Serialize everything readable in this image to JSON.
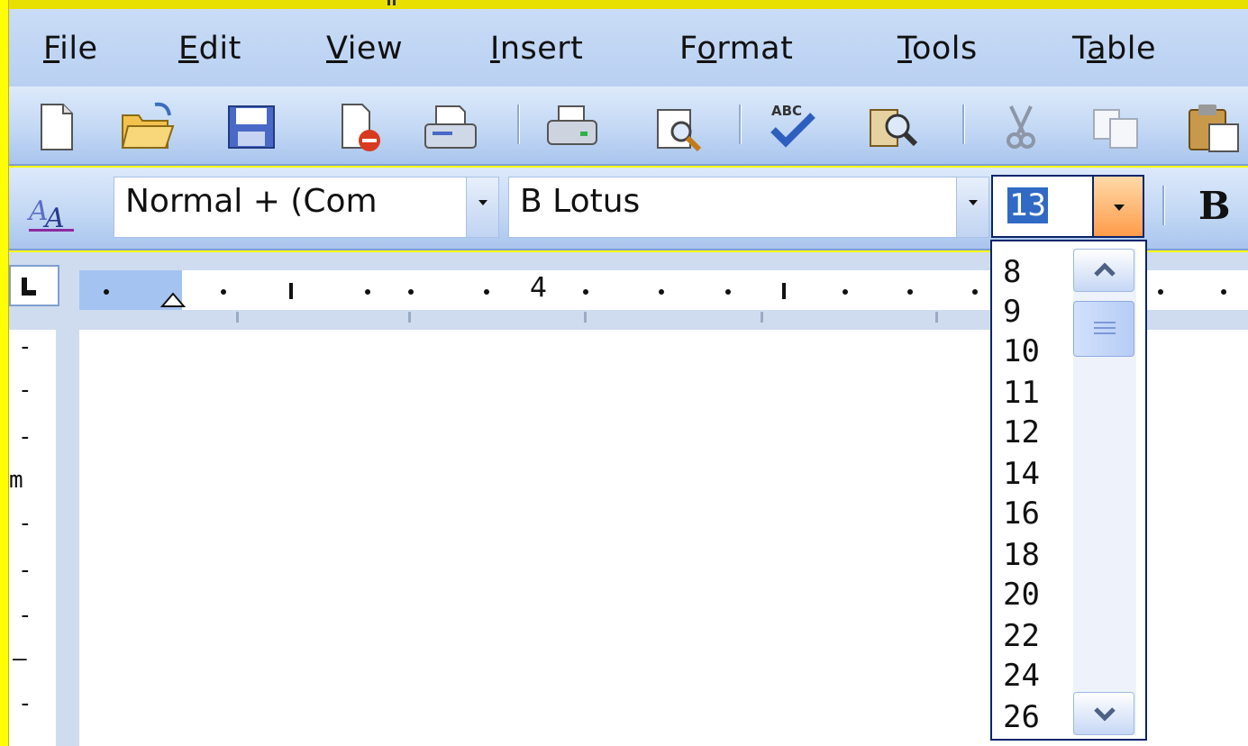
{
  "menu": {
    "items": [
      {
        "label": "File",
        "mnemonic": "F",
        "rest": "ile"
      },
      {
        "label": "Edit",
        "mnemonic": "E",
        "rest": "dit"
      },
      {
        "label": "View",
        "mnemonic": "V",
        "rest": "iew"
      },
      {
        "label": "Insert",
        "mnemonic": "I",
        "rest": "nsert"
      },
      {
        "label": "Format",
        "pre": "F",
        "mnemonic": "o",
        "rest": "rmat"
      },
      {
        "label": "Tools",
        "mnemonic": "T",
        "rest": "ools"
      },
      {
        "label": "Table",
        "pre": "T",
        "mnemonic": "a",
        "rest": "ble"
      }
    ]
  },
  "toolbar": {
    "icons": [
      "new-icon",
      "open-icon",
      "save-icon",
      "permission-icon",
      "email-icon",
      "print-icon",
      "print-preview-icon",
      "spelling-icon",
      "research-icon",
      "cut-icon",
      "copy-icon",
      "paste-icon"
    ]
  },
  "formatting": {
    "style_value": "Normal + (Com",
    "font_value": "B Lotus",
    "size_value": "13",
    "bold_label": "B"
  },
  "ruler": {
    "number": "4"
  },
  "size_list": {
    "options": [
      "8",
      "9",
      "10",
      "11",
      "12",
      "14",
      "16",
      "18",
      "20",
      "22",
      "24",
      "26"
    ]
  },
  "vertical_ruler": {
    "marks": [
      "-",
      "-",
      "-",
      "m",
      "-",
      "-",
      "-",
      "—",
      "-"
    ]
  },
  "colors": {
    "highlight": "#316ac5",
    "accent_arrow": "#ff9c4b",
    "frame": "#ffff00"
  }
}
